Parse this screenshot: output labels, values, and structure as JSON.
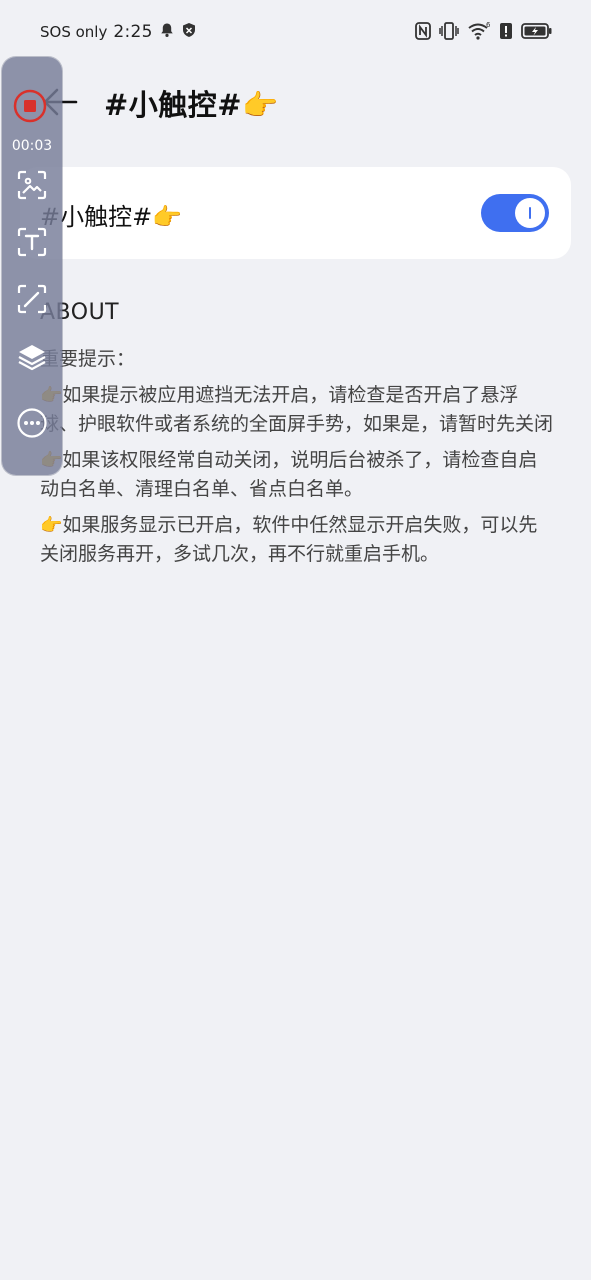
{
  "status_bar": {
    "carrier": "SOS only",
    "time": "2:25",
    "icons": [
      "bell-icon",
      "shield-icon",
      "nfc-icon",
      "vibrate-icon",
      "wifi-icon",
      "alert-icon",
      "battery-charging-icon"
    ],
    "wifi_badge": "6"
  },
  "header": {
    "title": "#小触控#👉"
  },
  "setting": {
    "label": "#小触控#👉",
    "enabled": true,
    "accent_color": "#3f6ff0"
  },
  "about": {
    "heading": "ABOUT",
    "notice_title": "重要提示：",
    "items": [
      {
        "emoji": "👉",
        "text": "如果提示被应用遮挡无法开启，请检查是否开启了悬浮球、护眼软件或者系统的全面屏手势，如果是，请暂时先关闭"
      },
      {
        "emoji": "👉",
        "text": "如果该权限经常自动关闭，说明后台被杀了，请检查自启动白名单、清理白名单、省点白名单。"
      },
      {
        "emoji": "👉",
        "text": "如果服务显示已开启，软件中任然显示开启失败，可以先关闭服务再开，多试几次，再不行就重启手机。"
      }
    ]
  },
  "recorder": {
    "elapsed": "00:03",
    "tools": [
      "screenshot-icon",
      "text-icon",
      "edit-icon",
      "layers-icon",
      "more-icon"
    ]
  }
}
